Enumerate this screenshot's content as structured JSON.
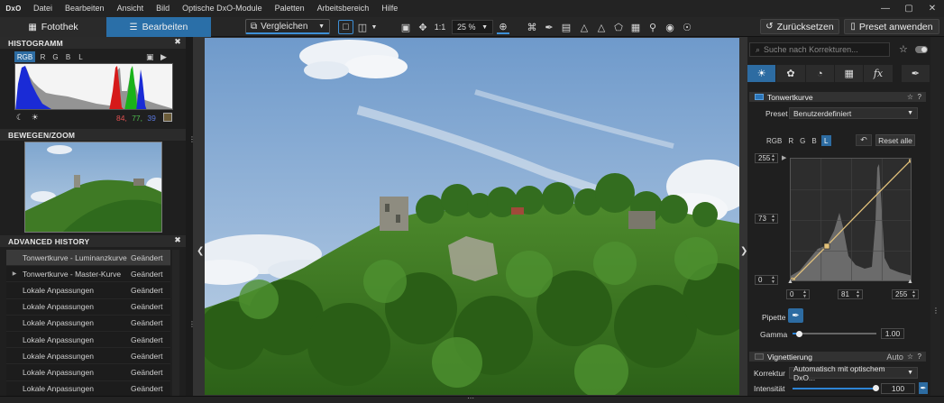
{
  "app": {
    "logo": "DxO",
    "menu": [
      "Datei",
      "Bearbeiten",
      "Ansicht",
      "Bild",
      "Optische DxO-Module",
      "Paletten",
      "Arbeitsbereich",
      "Hilfe"
    ],
    "window_controls": [
      "minimize-icon",
      "maximize-icon",
      "close-icon"
    ]
  },
  "toolbar": {
    "tab_fototek": "Fotothek",
    "tab_bearbeiten": "Bearbeiten",
    "compare_label": "Vergleichen",
    "one_to_one": "1:1",
    "zoom_value": "25 %",
    "reset_label": "Zurücksetzen",
    "preset_label": "Preset anwenden",
    "tool_icons": [
      "crop-icon",
      "eyedropper-icon",
      "horizon-icon",
      "perspective-icon",
      "local-adjust-icon",
      "grid-icon",
      "repair-icon",
      "eye-icon",
      "redeye-icon"
    ]
  },
  "histogram": {
    "title": "HISTOGRAMM",
    "channels": [
      "RGB",
      "R",
      "G",
      "B",
      "L"
    ],
    "active_channel": "RGB",
    "r": "84,",
    "g": "77,",
    "b": "39",
    "swatch_color": "#6b5c39"
  },
  "navigator": {
    "title": "BEWEGEN/ZOOM"
  },
  "history": {
    "title": "ADVANCED HISTORY",
    "rows": [
      {
        "label": "Tonwertkurve - Luminanzkurve",
        "status": "Geändert",
        "active": true
      },
      {
        "label": "Tonwertkurve - Master-Kurve",
        "status": "Geändert",
        "expand": true
      },
      {
        "label": "Lokale Anpassungen",
        "status": "Geändert"
      },
      {
        "label": "Lokale Anpassungen",
        "status": "Geändert"
      },
      {
        "label": "Lokale Anpassungen",
        "status": "Geändert"
      },
      {
        "label": "Lokale Anpassungen",
        "status": "Geändert"
      },
      {
        "label": "Lokale Anpassungen",
        "status": "Geändert"
      },
      {
        "label": "Lokale Anpassungen",
        "status": "Geändert"
      },
      {
        "label": "Lokale Anpassungen",
        "status": "Geändert"
      }
    ]
  },
  "right_panel": {
    "search_placeholder": "Suche nach Korrekturen...",
    "category_icons": [
      "light-icon",
      "color-icon",
      "detail-icon",
      "geometry-icon",
      "fx-icon",
      "local-icon"
    ],
    "tonecurve": {
      "title": "Tonwertkurve",
      "preset_label": "Preset",
      "preset_value": "Benutzerdefiniert",
      "channels": [
        "RGB",
        "R",
        "G",
        "B",
        "L"
      ],
      "active_channel": "L",
      "reset_all": "Reset alle",
      "y_top": "255",
      "y_mid": "73",
      "y_bottom": "0",
      "x_left": "0",
      "x_mid": "81",
      "x_right": "255",
      "pipette_label": "Pipette",
      "gamma_label": "Gamma",
      "gamma_value": "1.00",
      "gamma_fraction": 0.08
    },
    "vignetting": {
      "title": "Vignettierung",
      "auto": "Auto",
      "korrektur_label": "Korrektur",
      "korrektur_value": "Automatisch mit optischem DxO...",
      "intensity_label": "Intensität",
      "intensity_value": "100",
      "intensity_fraction": 1.0
    }
  }
}
